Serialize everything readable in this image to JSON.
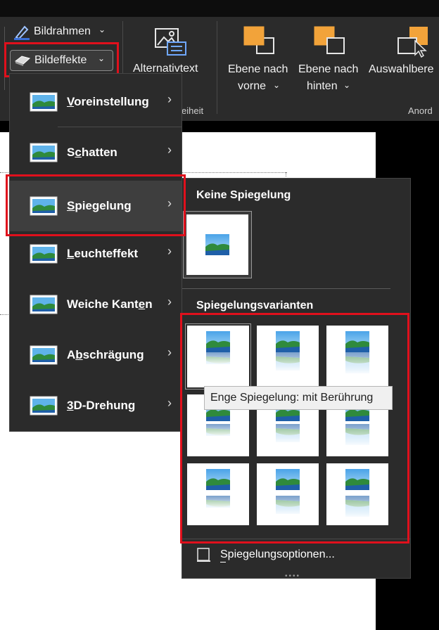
{
  "ribbon": {
    "picture_border": "Bildrahmen",
    "picture_effects": "Bildeffekte",
    "alt_text": "Alternativtext",
    "accessibility_partial": "eiheit",
    "bring_forward_line1": "Ebene nach",
    "bring_forward_line2": "vorne",
    "send_backward_line1": "Ebene nach",
    "send_backward_line2": "hinten",
    "selection_pane": "Auswahlbere",
    "arrange_partial": "Anord"
  },
  "effects_menu": {
    "items": [
      {
        "pre": "",
        "u": "V",
        "post": "oreinstellung"
      },
      {
        "pre": "S",
        "u": "c",
        "post": "hatten"
      },
      {
        "pre": "",
        "u": "S",
        "post": "piegelung"
      },
      {
        "pre": "",
        "u": "L",
        "post": "euchteffekt"
      },
      {
        "pre": "Weiche Kant",
        "u": "e",
        "post": "n"
      },
      {
        "pre": "A",
        "u": "b",
        "post": "schrägung"
      },
      {
        "pre": "",
        "u": "3",
        "post": "D-Drehung"
      }
    ]
  },
  "reflection_menu": {
    "no_reflection_header": "Keine Spiegelung",
    "variants_header": "Spiegelungsvarianten",
    "options_label": "Spiegelungsoptionen...",
    "tooltip": "Enge Spiegelung: mit Berührung"
  },
  "colors": {
    "highlight": "#e0101c",
    "menu_bg": "#2b2b2b",
    "ribbon_bg": "#2b2b2b",
    "accent_orange": "#f2a33a"
  }
}
